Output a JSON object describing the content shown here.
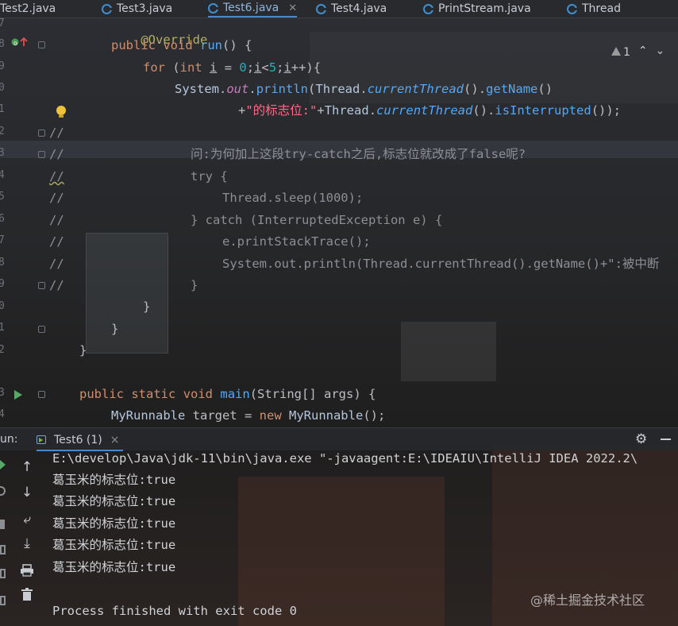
{
  "tabs": [
    {
      "label": "Test2.java",
      "active": false
    },
    {
      "label": "Test3.java",
      "active": false
    },
    {
      "label": "Test6.java",
      "active": true
    },
    {
      "label": "Test4.java",
      "active": false
    },
    {
      "label": "PrintStream.java",
      "active": false
    },
    {
      "label": "Thread",
      "active": false
    }
  ],
  "inspection": {
    "warnings": "1"
  },
  "gutter": {
    "n1": "7",
    "n2": "8",
    "n3": "9",
    "n4": "0",
    "n5": "1",
    "n6": "2",
    "n7": "3",
    "n8": "4",
    "n9": "5",
    "n10": "6",
    "n11": "7",
    "n12": "8",
    "n13": "9",
    "n14": "0",
    "n15": "1",
    "n16": "2",
    "n17": "3",
    "n18": "4"
  },
  "code": {
    "l0": "@Override",
    "l1_kw1": "public",
    "l1_kw2": "void",
    "l1_fn": "run",
    "l1_rest": "() {",
    "l2_kw": "for",
    "l2_p": " (",
    "l2_kw2": "int",
    "l2_var": "i",
    "l2_eq": " = ",
    "l2_n0": "0",
    "l2_s1": ";",
    "l2_var2": "i",
    "l2_lt": "<",
    "l2_n5": "5",
    "l2_s2": ";",
    "l2_var3": "i",
    "l2_end": "++){",
    "l3_cls": "System",
    "l3_dot": ".",
    "l3_field": "out",
    "l3_dot2": ".",
    "l3_fn": "println",
    "l3_p": "(",
    "l3_cls2": "Thread",
    "l3_dot3": ".",
    "l3_fn2": "currentThread",
    "l3_p2": "().",
    "l3_fn3": "getName",
    "l3_p3": "()",
    "l4_plus": "+",
    "l4_str": "\"的标志位:\"",
    "l4_plus2": "+",
    "l4_cls": "Thread",
    "l4_dot": ".",
    "l4_fn": "currentThread",
    "l4_p": "().",
    "l4_fn2": "isInterrupted",
    "l4_end": "());",
    "c1": "//",
    "c2_pre": "//",
    "c2": "问:为何加上这段try-catch之后,标志位就改成了false呢?",
    "c3_pre": "//",
    "c3": "try {",
    "c4_pre": "//",
    "c4": "Thread.sleep(1000);",
    "c5_pre": "//",
    "c5": "} catch (InterruptedException e) {",
    "c6_pre": "//",
    "c6": "e.printStackTrace();",
    "c7_pre": "//",
    "c7": "System.out.println(Thread.currentThread().getName()+\":被中断",
    "c8_pre": "//",
    "c8": "}",
    "b1": "}",
    "b2": "}",
    "b3": "}",
    "m_kw1": "public",
    "m_kw2": "static",
    "m_kw3": "void",
    "m_fn": "main",
    "m_rest": "(String[] args) {",
    "t_cls": "MyRunnable",
    "t_var": " target = ",
    "t_kw": "new",
    "t_cls2": " MyRunnable",
    "t_end": "();"
  },
  "run": {
    "label": "un:",
    "tab": "Test6 (1)",
    "close": "×"
  },
  "console": {
    "cmd": "E:\\develop\\Java\\jdk-11\\bin\\java.exe \"-javaagent:E:\\IDEAIU\\IntelliJ IDEA 2022.2\\",
    "out1": "葛玉米的标志位:true",
    "out2": "葛玉米的标志位:true",
    "out3": "葛玉米的标志位:true",
    "out4": "葛玉米的标志位:true",
    "out5": "葛玉米的标志位:true",
    "exit": "Process finished with exit code 0"
  },
  "watermark": "@稀土掘金技术社区",
  "colors": {
    "accent": "#4a88c7",
    "keyword": "#cf8e6d",
    "method": "#56a8f5",
    "string": "#ff6b8a"
  }
}
